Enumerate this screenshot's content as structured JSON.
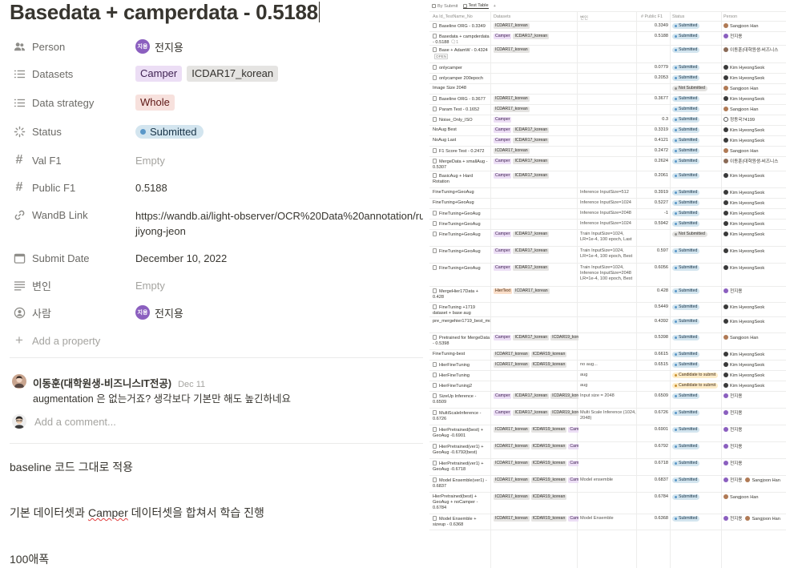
{
  "page": {
    "title": "Basedata + camperdata - 0.5188",
    "properties": {
      "person": {
        "label": "Person",
        "avatar": "지용",
        "value": "전지용"
      },
      "datasets": {
        "label": "Datasets",
        "tags": [
          "Camper",
          "ICDAR17_korean"
        ]
      },
      "strategy": {
        "label": "Data strategy",
        "tag": "Whole"
      },
      "status": {
        "label": "Status",
        "value": "Submitted"
      },
      "val_f1": {
        "label": "Val F1",
        "value": "Empty"
      },
      "public_f1": {
        "label": "Public F1",
        "value": "0.5188"
      },
      "wandb": {
        "label": "WandB Link",
        "line1": "https://wandb.ai/light-observer/OCR%20Data%20annotation/ru",
        "line2": "jiyong-jeon"
      },
      "submit_date": {
        "label": "Submit Date",
        "value": "December 10, 2022"
      },
      "variable": {
        "label": "변인",
        "value": "Empty"
      },
      "people": {
        "label": "사람",
        "avatar": "지용",
        "value": "전지용"
      },
      "add_property": "Add a property"
    },
    "comment": {
      "author": "이동훈(대학원생-비즈니스IT전공)",
      "date": "Dec 11",
      "text": "augmentation 은 없는거죠? 생각보다 기본만 해도 높긴하네요"
    },
    "add_comment_placeholder": "Add a comment...",
    "body": {
      "p1": "baseline 코드 그대로 적용",
      "p2_pre": "기본 데이터셋과 ",
      "p2_word": "Camper",
      "p2_post": " 데이터셋을 합쳐서 학습 진행",
      "p3": "100애폭"
    }
  },
  "table": {
    "views": [
      "By Submit",
      "Test Table",
      "+"
    ],
    "headers": [
      "Aa Id_TestName_No",
      "Datasets",
      "변인",
      "# Public F1",
      "Status",
      "Person"
    ],
    "rows": [
      {
        "name": "Baseline ORG - 0.3349",
        "page": true,
        "datasets": [
          "ICDAR17_korean"
        ],
        "note": "",
        "f1": "0.3349",
        "status": "Submitted",
        "persons": [
          {
            "n": "Sangjoon Han",
            "c": "han"
          }
        ],
        "h": 13
      },
      {
        "name": "Basedata + campderdata - 0.5188",
        "page": true,
        "comment": "1",
        "datasets": [
          "Camper",
          "ICDAR17_korean"
        ],
        "note": "",
        "f1": "0.5188",
        "status": "Submitted",
        "persons": [
          {
            "n": "전지용",
            "c": "jeon"
          }
        ],
        "h": 17
      },
      {
        "name": "Base + AdamW - 0.4324",
        "page": true,
        "open": "OPEN",
        "datasets": [
          "ICDAR17_korean"
        ],
        "note": "",
        "f1": "",
        "status": "Submitted",
        "persons": [
          {
            "n": "이동훈(대학원생-비즈니스",
            "c": "lee"
          }
        ],
        "h": 22
      },
      {
        "name": "onlycamper",
        "page": true,
        "datasets": [],
        "note": "",
        "f1": "0.0779",
        "status": "Submitted",
        "persons": [
          {
            "n": "Kim HyeongSeok",
            "c": "kim"
          }
        ],
        "h": 13
      },
      {
        "name": "onlycamper 200epoch",
        "page": true,
        "datasets": [],
        "note": "",
        "f1": "0.2053",
        "status": "Submitted",
        "persons": [
          {
            "n": "Kim HyeongSeok",
            "c": "kim"
          }
        ],
        "h": 13
      },
      {
        "name": "Image Size 2048",
        "page": false,
        "datasets": [],
        "note": "",
        "f1": "",
        "status": "Not Submitted",
        "persons": [
          {
            "n": "Sangjoon Han",
            "c": "han"
          }
        ],
        "h": 13
      },
      {
        "name": "Baseline ORG - 0.3677",
        "page": true,
        "datasets": [
          "ICDAR17_korean"
        ],
        "note": "",
        "f1": "0.3677",
        "status": "Submitted",
        "persons": [
          {
            "n": "Kim HyeongSeok",
            "c": "kim"
          }
        ],
        "h": 13
      },
      {
        "name": "Param Test - 0.1652",
        "page": true,
        "datasets": [
          "ICDAR17_korean"
        ],
        "note": "",
        "f1": "",
        "status": "Submitted",
        "persons": [
          {
            "n": "Sangjoon Han",
            "c": "han"
          }
        ],
        "h": 13
      },
      {
        "name": "Noise_Only_ISO",
        "page": true,
        "datasets": [
          "Camper"
        ],
        "note": "",
        "f1": "0.3",
        "status": "Submitted",
        "persons": [
          {
            "n": "정동국74199",
            "c": "jung"
          }
        ],
        "h": 13
      },
      {
        "name": "NoAug Best",
        "page": false,
        "datasets": [
          "Camper",
          "ICDAR17_korean"
        ],
        "note": "",
        "f1": "0.3319",
        "status": "Submitted",
        "persons": [
          {
            "n": "Kim HyeongSeok",
            "c": "kim"
          }
        ],
        "h": 13
      },
      {
        "name": "NoAug Last",
        "page": false,
        "datasets": [
          "Camper",
          "ICDAR17_korean"
        ],
        "note": "",
        "f1": "0.4121",
        "status": "Submitted",
        "persons": [
          {
            "n": "Kim HyeongSeok",
            "c": "kim"
          }
        ],
        "h": 13
      },
      {
        "name": "F1 Score Test - 0.2472",
        "page": true,
        "datasets": [
          "ICDAR17_korean"
        ],
        "note": "",
        "f1": "0.2472",
        "status": "Submitted",
        "persons": [
          {
            "n": "Sangjoon Han",
            "c": "han"
          }
        ],
        "h": 13
      },
      {
        "name": "MergeData + smallAug - 0.5307",
        "page": true,
        "datasets": [
          "Camper",
          "ICDAR17_korean"
        ],
        "note": "",
        "f1": "0.2624",
        "status": "Submitted",
        "persons": [
          {
            "n": "이동훈(대학원생-비즈니스",
            "c": "lee"
          }
        ],
        "h": 18
      },
      {
        "name": "BasicAug + Hard Rotation",
        "page": true,
        "datasets": [
          "Camper",
          "ICDAR17_korean"
        ],
        "note": "",
        "f1": "0.2061",
        "status": "Submitted",
        "persons": [
          {
            "n": "Kim HyeongSeok",
            "c": "kim"
          }
        ],
        "h": 21
      },
      {
        "name": "FineTuning+GeoAug",
        "page": false,
        "datasets": [],
        "note": "Inference InputSize=512",
        "f1": "0.3919",
        "status": "Submitted",
        "persons": [
          {
            "n": "Kim HyeongSeok",
            "c": "kim"
          }
        ],
        "h": 13
      },
      {
        "name": "FineTuning+GeoAug",
        "page": false,
        "datasets": [],
        "note": "Inference InputSize=1024",
        "f1": "0.5227",
        "status": "Submitted",
        "persons": [
          {
            "n": "Kim HyeongSeok",
            "c": "kim"
          }
        ],
        "h": 13
      },
      {
        "name": "FineTuning+GeoAug",
        "page": true,
        "datasets": [],
        "note": "Inference InputSize=2048",
        "f1": "-1",
        "status": "Submitted",
        "persons": [
          {
            "n": "Kim HyeongSeok",
            "c": "kim"
          }
        ],
        "h": 13
      },
      {
        "name": "FineTuning+GeoAug",
        "page": true,
        "datasets": [],
        "note": "Inference InputSize=1024",
        "f1": "0.5942",
        "status": "Submitted",
        "persons": [
          {
            "n": "Kim HyeongSeok",
            "c": "kim"
          }
        ],
        "h": 13
      },
      {
        "name": "FineTuning+GeoAug",
        "page": true,
        "datasets": [
          "Camper",
          "ICDAR17_korean"
        ],
        "note": "Train InputSize=1024, LR=1e-4, 100 epoch, Last",
        "f1": "",
        "status": "Not Submitted",
        "persons": [
          {
            "n": "Kim HyeongSeok",
            "c": "kim"
          }
        ],
        "h": 21
      },
      {
        "name": "FineTuning+GeoAug",
        "page": true,
        "datasets": [
          "Camper",
          "ICDAR17_korean"
        ],
        "note": "Train InputSize=1024, LR=1e-4, 100 epoch, Best",
        "f1": "0.597",
        "status": "Submitted",
        "persons": [
          {
            "n": "Kim HyeongSeok",
            "c": "kim"
          }
        ],
        "h": 21
      },
      {
        "name": "FineTuning+GeoAug",
        "page": true,
        "datasets": [
          "Camper",
          "ICDAR17_korean"
        ],
        "note": "Train InputSize=1024, Inference InputSize=2048 LR=1e-4, 100 epoch, Best",
        "f1": "0.6056",
        "status": "Submitted",
        "persons": [
          {
            "n": "Kim HyeongSeok",
            "c": "kim"
          }
        ],
        "h": 29
      },
      {
        "name": "MergeHier17Data + 0.428",
        "page": true,
        "datasets": [
          "HierText",
          "ICDAR17_korean"
        ],
        "note": "",
        "f1": "0.428",
        "status": "Submitted",
        "persons": [
          {
            "n": "전지용",
            "c": "jeon"
          }
        ],
        "h": 20
      },
      {
        "name": "FineTuning +1719 dataset + base aug",
        "page": true,
        "datasets": [],
        "note": "",
        "f1": "0.5449",
        "status": "Submitted",
        "persons": [
          {
            "n": "Kim HyeongSeok",
            "c": "kim"
          }
        ],
        "h": 18
      },
      {
        "name": "pre_mergehier1719_best_model",
        "page": false,
        "datasets": [],
        "note": "",
        "f1": "0.4392",
        "status": "Submitted",
        "persons": [
          {
            "n": "Kim HyeongSeok",
            "c": "kim"
          }
        ],
        "h": 20
      },
      {
        "name": "Pretrained for MergeData - 0.5398",
        "page": true,
        "datasets": [
          "Camper",
          "ICDAR17_korean",
          "ICDAR19_korean"
        ],
        "note": "",
        "f1": "0.5398",
        "status": "Submitted",
        "persons": [
          {
            "n": "Sangjoon Han",
            "c": "han"
          }
        ],
        "h": 21
      },
      {
        "name": "FineTuning-best",
        "page": false,
        "datasets": [
          "ICDAR17_korean",
          "ICDAR19_korean"
        ],
        "note": "",
        "f1": "0.6615",
        "status": "Submitted",
        "persons": [
          {
            "n": "Kim HyeongSeok",
            "c": "kim"
          }
        ],
        "h": 13
      },
      {
        "name": "HierFineTuning",
        "page": true,
        "datasets": [
          "ICDAR17_korean",
          "ICDAR19_korean"
        ],
        "note": "no aug...",
        "f1": "0.6515",
        "status": "Submitted",
        "persons": [
          {
            "n": "Kim HyeongSeok",
            "c": "kim"
          }
        ],
        "h": 13
      },
      {
        "name": "HierFineTuning",
        "page": true,
        "datasets": [],
        "note": "aug",
        "f1": "",
        "status": "Candidate to submit",
        "persons": [
          {
            "n": "Kim HyeongSeok",
            "c": "kim"
          }
        ],
        "h": 13
      },
      {
        "name": "HierFineTuning2",
        "page": true,
        "datasets": [],
        "note": "aug",
        "f1": "",
        "status": "Candidate to submit",
        "persons": [
          {
            "n": "Kim HyeongSeok",
            "c": "kim"
          }
        ],
        "h": 13
      },
      {
        "name": "SizeUp Inference - 0.6509",
        "page": true,
        "datasets": [
          "Camper",
          "ICDAR17_korean",
          "ICDAR19_korean"
        ],
        "note": "Input size = 2048",
        "f1": "0.6509",
        "status": "Submitted",
        "persons": [
          {
            "n": "전지용",
            "c": "jeon"
          }
        ],
        "h": 21
      },
      {
        "name": "MultiScaleInference - 0.6726",
        "page": true,
        "datasets": [
          "Camper",
          "ICDAR17_korean",
          "ICDAR19_korean"
        ],
        "note": "Multi Scale Inference (1024, 2048)",
        "f1": "0.6726",
        "status": "Submitted",
        "persons": [
          {
            "n": "전지용",
            "c": "jeon"
          }
        ],
        "h": 21
      },
      {
        "name": "HierPretrained(best) + GeoAug -0.6901",
        "page": true,
        "datasets": [
          "ICDAR17_korean",
          "ICDAR19_korean",
          "Camper"
        ],
        "note": "",
        "f1": "0.6901",
        "status": "Submitted",
        "persons": [
          {
            "n": "전지용",
            "c": "jeon"
          }
        ],
        "h": 21
      },
      {
        "name": "HierPretrained(ver1) + GeoAug -0.6792(best)",
        "page": true,
        "datasets": [
          "ICDAR17_korean",
          "ICDAR19_korean",
          "Camper"
        ],
        "note": "",
        "f1": "0.6792",
        "status": "Submitted",
        "persons": [
          {
            "n": "전지용",
            "c": "jeon"
          }
        ],
        "h": 21
      },
      {
        "name": "HierPretrained(ver1) + GeoAug -0.6718",
        "page": true,
        "datasets": [
          "ICDAR17_korean",
          "ICDAR19_korean",
          "Camper"
        ],
        "note": "",
        "f1": "0.6718",
        "status": "Submitted",
        "persons": [
          {
            "n": "전지용",
            "c": "jeon"
          }
        ],
        "h": 21
      },
      {
        "name": "Model Ensemble(ver1) - 0.6837",
        "page": true,
        "datasets": [
          "ICDAR17_korean",
          "ICDAR19_korean",
          "Camper"
        ],
        "note": "Model ensemble",
        "f1": "0.6837",
        "status": "Submitted",
        "persons": [
          {
            "n": "전지용",
            "c": "jeon"
          },
          {
            "n": "Sangjoon Han",
            "c": "han"
          }
        ],
        "h": 21
      },
      {
        "name": "HierPretrained(best) + GeoAug + noCamper - 0.6784",
        "page": false,
        "datasets": [
          "ICDAR17_korean",
          "ICDAR19_korean"
        ],
        "note": "",
        "f1": "0.6784",
        "status": "Submitted",
        "persons": [
          {
            "n": "Sangjoon Han",
            "c": "han"
          }
        ],
        "h": 27
      },
      {
        "name": "Model Ensemble + sizeup - 0.6368",
        "page": true,
        "datasets": [
          "ICDAR17_korean",
          "ICDAR19_korean",
          "Camper"
        ],
        "note": "Model Ensemble",
        "f1": "0.6368",
        "status": "Submitted",
        "persons": [
          {
            "n": "전지용",
            "c": "jeon"
          },
          {
            "n": "Sangjoon Han",
            "c": "han"
          }
        ],
        "h": 20
      }
    ]
  }
}
